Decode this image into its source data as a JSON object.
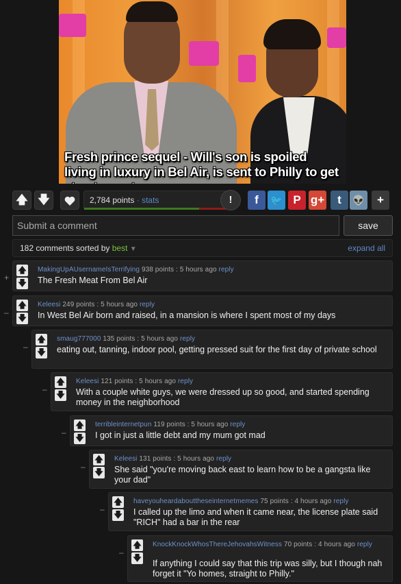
{
  "post": {
    "caption": "Fresh prince sequel - Will's son is spoiled living in luxury in Bel Air, is sent to Philly to get street-smart"
  },
  "actions": {
    "upvote": "🡅",
    "downvote": "🡇",
    "points": "2,784 points",
    "sep": "·",
    "stats": "stats",
    "upvote_ratio": 0.8,
    "alert": "!",
    "social": [
      {
        "name": "facebook-icon",
        "glyph": "f",
        "color": "#3b5998"
      },
      {
        "name": "twitter-icon",
        "glyph": "🐦",
        "color": "#2b8fd0"
      },
      {
        "name": "pinterest-icon",
        "glyph": "P",
        "color": "#c8232c"
      },
      {
        "name": "googleplus-icon",
        "glyph": "g+",
        "color": "#d34836"
      },
      {
        "name": "tumblr-icon",
        "glyph": "t",
        "color": "#3a5a7a"
      },
      {
        "name": "reddit-icon",
        "glyph": "👽",
        "color": "#6f8fa8"
      },
      {
        "name": "plus-icon",
        "glyph": "+",
        "color": "#3a3a3a"
      }
    ]
  },
  "comment_form": {
    "placeholder": "Submit a comment",
    "save_label": "save"
  },
  "sortbar": {
    "count": "182 comments sorted by ",
    "sort": "best",
    "expand": "expand all"
  },
  "comments": [
    {
      "user": "MakingUpAUsernameIsTerrifying",
      "meta": "938 points : 5 hours ago",
      "reply": "reply",
      "text": "The Fresh Meat From Bel Air",
      "toggle": "+"
    },
    {
      "user": "Keleesi",
      "meta": "249 points : 5 hours ago",
      "reply": "reply",
      "text": "In West Bel Air born and raised, in a mansion is where I spent most of my days",
      "toggle": "–"
    },
    {
      "user": "smaug777000",
      "meta": "135 points : 5 hours ago",
      "reply": "reply",
      "text": "eating out, tanning, indoor pool, getting pressed suit for the first day of private school",
      "toggle": "–"
    },
    {
      "user": "Keleesi",
      "meta": "121 points : 5 hours ago",
      "reply": "reply",
      "text": "With a couple white guys, we were dressed up so good, and started spending money in the neighborhood",
      "toggle": "–"
    },
    {
      "user": "terribleinternetpun",
      "meta": "119 points : 5 hours ago",
      "reply": "reply",
      "text": "I got in just a little debt and my mum got mad",
      "toggle": "–"
    },
    {
      "user": "Keleesi",
      "meta": "131 points : 5 hours ago",
      "reply": "reply",
      "text": "She said \"you're moving back east to learn how to be a gangsta like your dad\"",
      "toggle": "–"
    },
    {
      "user": "haveyouheardabouttheseinternetmemes",
      "meta": "75 points : 4 hours ago",
      "reply": "reply",
      "text": "I called up the limo and when it came near, the license plate said \"RICH\" had a bar in the rear",
      "toggle": "–"
    },
    {
      "user": "KnockKnockWhosThereJehovahsWitness",
      "meta": "70 points : 4 hours ago",
      "reply": "reply",
      "text": "If anything I could say that this trip was silly, but I though nah forget it \"Yo homes, straight to Philly.\"",
      "toggle": "–"
    }
  ]
}
